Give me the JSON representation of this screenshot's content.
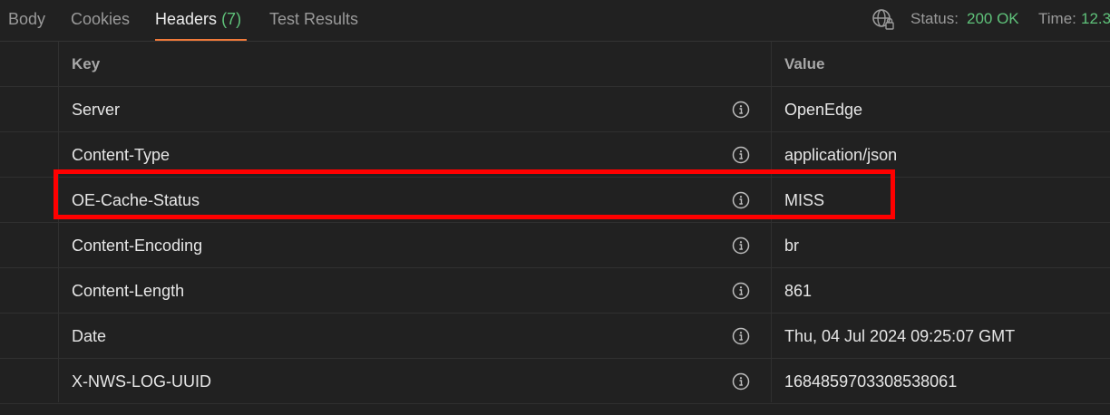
{
  "tabs": [
    {
      "label": "Body"
    },
    {
      "label": "Cookies"
    },
    {
      "label": "Headers",
      "count": "(7)",
      "active": true
    },
    {
      "label": "Test Results"
    }
  ],
  "status": {
    "status_label": "Status:",
    "status_value": "200 OK",
    "time_label": "Time:",
    "time_value": "12.3"
  },
  "table": {
    "headers": {
      "key": "Key",
      "value": "Value"
    },
    "rows": [
      {
        "key": "Server",
        "value": "OpenEdge"
      },
      {
        "key": "Content-Type",
        "value": "application/json"
      },
      {
        "key": "OE-Cache-Status",
        "value": "MISS"
      },
      {
        "key": "Content-Encoding",
        "value": "br"
      },
      {
        "key": "Content-Length",
        "value": "861"
      },
      {
        "key": "Date",
        "value": "Thu, 04 Jul 2024 09:25:07 GMT"
      },
      {
        "key": "X-NWS-LOG-UUID",
        "value": "1684859703308538061"
      }
    ]
  },
  "colors": {
    "background": "#212121",
    "accent": "#f07a3a",
    "success": "#5fc27a",
    "highlight": "#ff0000"
  }
}
